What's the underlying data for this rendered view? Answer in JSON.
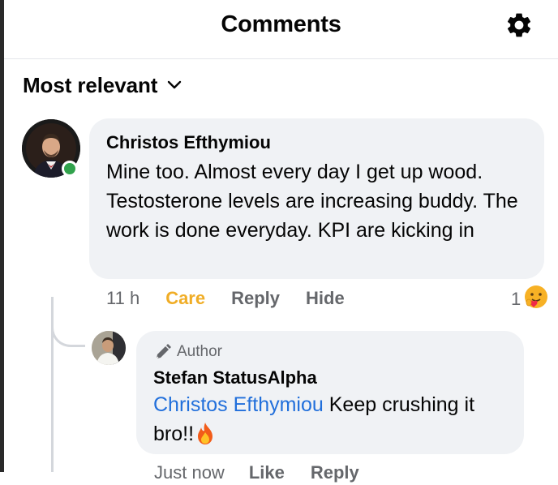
{
  "header": {
    "title": "Comments",
    "settings_icon": "gear-icon"
  },
  "sort": {
    "label": "Most relevant",
    "icon": "chevron-down-icon"
  },
  "comment": {
    "author": "Christos Efthymiou",
    "text": "Mine too. Almost every day I get up wood. Testosterone levels are increasing buddy. The work is done everyday. KPI are kicking in",
    "online": true,
    "time": "11 h",
    "care_label": "Care",
    "reply_label": "Reply",
    "hide_label": "Hide",
    "reaction_count": "1",
    "reaction_emoji": "🤗",
    "care_color": "#f0ad26"
  },
  "reply": {
    "badge": "Author",
    "badge_icon": "pen-icon",
    "author": "Stefan StatusAlpha",
    "mention": "Christos Efthymiou",
    "text": " Keep crushing it bro!!",
    "emoji": "🔥",
    "time": "Just now",
    "like_label": "Like",
    "reply_label": "Reply",
    "mention_color": "#216fdb"
  }
}
